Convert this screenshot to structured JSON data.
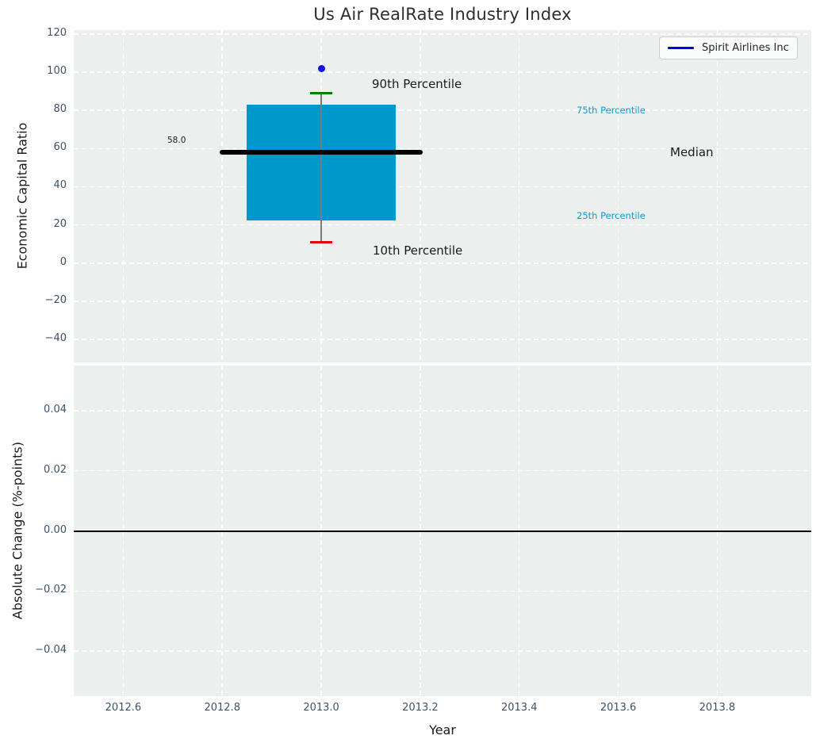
{
  "title": "Us Air RealRate Industry Index",
  "legend": {
    "label": "Spirit Airlines Inc",
    "line_color": "#0202dd"
  },
  "annotations": {
    "p90": "90th Percentile",
    "p10": "10th Percentile",
    "p75": "75th Percentile",
    "p25": "25th Percentile",
    "median": "Median",
    "median_value": "58.0"
  },
  "colors": {
    "plot_background": "#ebefee",
    "grid": "#ffffff",
    "box_fill": "#0099cc",
    "median_line": "#000000",
    "whisker": "#7a7a7a",
    "p90_cap": "#008000",
    "p10_cap": "#e60000",
    "company_point": "#1414e6",
    "tick_label": "#3d5166",
    "percentile_text_cyan": "#0d9bd1",
    "zero_line": "#000000"
  },
  "chart_data": [
    {
      "type": "box",
      "panel": "top",
      "title": "Us Air RealRate Industry Index",
      "ylabel": "Economic Capital Ratio",
      "ylim": [
        -52,
        122
      ],
      "xlim": [
        2012.5,
        2013.99
      ],
      "grid": true,
      "yticks": [
        {
          "v": 120,
          "label": "120"
        },
        {
          "v": 100,
          "label": "100"
        },
        {
          "v": 80,
          "label": "80"
        },
        {
          "v": 60,
          "label": "60"
        },
        {
          "v": 40,
          "label": "40"
        },
        {
          "v": 20,
          "label": "20"
        },
        {
          "v": 0,
          "label": "0"
        },
        {
          "v": -20,
          "label": "−20"
        },
        {
          "v": -40,
          "label": "−40"
        }
      ],
      "xticks": [
        {
          "v": 2012.6
        },
        {
          "v": 2012.8
        },
        {
          "v": 2013.0
        },
        {
          "v": 2013.2
        },
        {
          "v": 2013.4
        },
        {
          "v": 2013.6
        },
        {
          "v": 2013.8
        }
      ],
      "show_x_tick_labels": false,
      "box": {
        "x": 2013.0,
        "p10": 11,
        "q1": 22.4,
        "median": 58.0,
        "q3": 82.9,
        "p90": 89,
        "half_width": 0.15,
        "median_half_width": 0.205,
        "cap_half_width": 0.022
      },
      "point": {
        "name": "Spirit Airlines Inc",
        "x": 2013.0,
        "y": 102
      }
    },
    {
      "type": "line",
      "panel": "bottom",
      "ylabel": "Absolute Change (%-points)",
      "xlabel": "Year",
      "ylim": [
        -0.055,
        0.055
      ],
      "xlim": [
        2012.5,
        2013.99
      ],
      "grid": true,
      "yticks": [
        {
          "v": 0.04,
          "label": "0.04"
        },
        {
          "v": 0.02,
          "label": "0.02"
        },
        {
          "v": 0.0,
          "label": "0.00"
        },
        {
          "v": -0.02,
          "label": "−0.02"
        },
        {
          "v": -0.04,
          "label": "−0.04"
        }
      ],
      "xticks": [
        {
          "v": 2012.6,
          "label": "2012.6"
        },
        {
          "v": 2012.8,
          "label": "2012.8"
        },
        {
          "v": 2013.0,
          "label": "2013.0"
        },
        {
          "v": 2013.2,
          "label": "2013.2"
        },
        {
          "v": 2013.4,
          "label": "2013.4"
        },
        {
          "v": 2013.6,
          "label": "2013.6"
        },
        {
          "v": 2013.8,
          "label": "2013.8"
        }
      ],
      "show_x_tick_labels": true,
      "zero_line": 0.0,
      "series": [
        {
          "name": "Spirit Airlines Inc",
          "x": [],
          "y": []
        }
      ]
    }
  ]
}
